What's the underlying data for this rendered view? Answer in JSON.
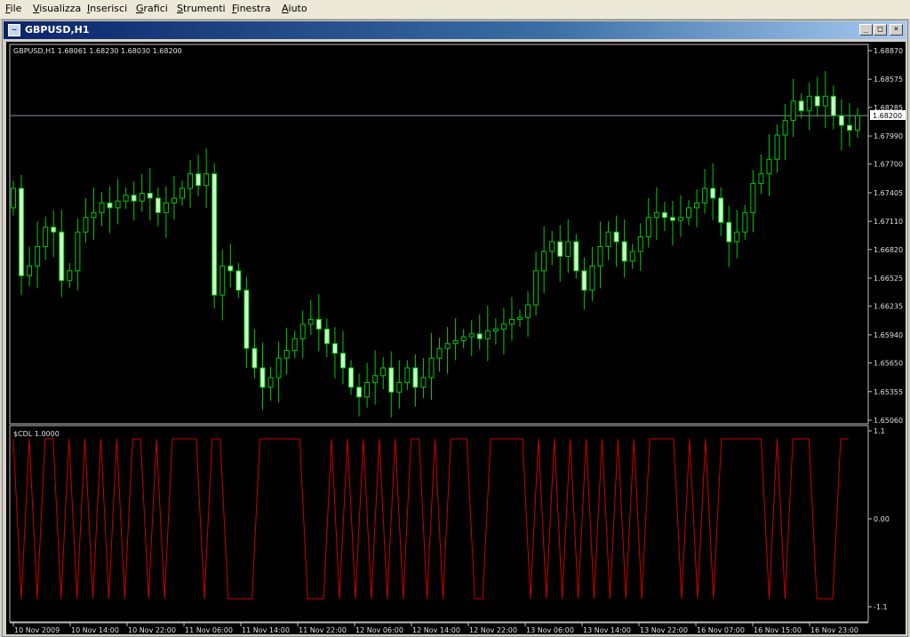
{
  "menu": {
    "items": [
      "File",
      "Visualizza",
      "Inserisci",
      "Grafici",
      "Strumenti",
      "Finestra",
      "Aiuto"
    ]
  },
  "window": {
    "title": "GBPUSD,H1",
    "buttons": {
      "minimize": "_",
      "maximize": "□",
      "close": "×"
    }
  },
  "chart": {
    "header": "GBPUSD,H1  1.68061 1.68230 1.68030 1.68200",
    "indicator_label": "$CDL 1.0000",
    "current_price_label": "1.68200",
    "colors": {
      "background": "#000000",
      "bull_candle": "#ccffcc",
      "wick": "#00cc00",
      "indicator_line": "#cc0000",
      "bid_line": "#7f8fa6"
    }
  },
  "chart_data": [
    {
      "type": "candlestick",
      "title": "GBPUSD,H1",
      "ohlc_last": {
        "open": 1.68061,
        "high": 1.6823,
        "low": 1.6803,
        "close": 1.682
      },
      "y_ticks": [
        "1.68870",
        "1.68575",
        "1.68285",
        "1.67990",
        "1.67700",
        "1.67405",
        "1.67110",
        "1.66820",
        "1.66525",
        "1.66235",
        "1.65940",
        "1.65650",
        "1.65355",
        "1.65060"
      ],
      "ylim": [
        1.6506,
        1.6887
      ],
      "current_price": 1.682,
      "x_ticks": [
        "10 Nov 2009",
        "10 Nov 14:00",
        "10 Nov 22:00",
        "11 Nov 06:00",
        "11 Nov 14:00",
        "11 Nov 22:00",
        "12 Nov 06:00",
        "12 Nov 14:00",
        "12 Nov 22:00",
        "13 Nov 06:00",
        "13 Nov 14:00",
        "13 Nov 22:00",
        "16 Nov 07:00",
        "16 Nov 15:00",
        "16 Nov 23:00"
      ],
      "closes": [
        1.6745,
        1.6655,
        1.6665,
        1.6685,
        1.6705,
        1.67,
        1.665,
        1.666,
        1.67,
        1.6715,
        1.672,
        1.673,
        1.6725,
        1.6732,
        1.6738,
        1.6732,
        1.674,
        1.6735,
        1.672,
        1.673,
        1.6735,
        1.6745,
        1.676,
        1.6748,
        1.676,
        1.6635,
        1.6665,
        1.666,
        1.664,
        1.658,
        1.656,
        1.654,
        1.655,
        1.657,
        1.6578,
        1.659,
        1.6605,
        1.661,
        1.66,
        1.6585,
        1.6575,
        1.656,
        1.654,
        1.653,
        1.6545,
        1.6552,
        1.656,
        1.6535,
        1.6545,
        1.656,
        1.654,
        1.655,
        1.657,
        1.658,
        1.6585,
        1.6588,
        1.6592,
        1.6595,
        1.659,
        1.6598,
        1.66,
        1.6605,
        1.661,
        1.6612,
        1.6625,
        1.666,
        1.668,
        1.669,
        1.6675,
        1.669,
        1.666,
        1.664,
        1.6665,
        1.6685,
        1.67,
        1.669,
        1.667,
        1.668,
        1.6695,
        1.6715,
        1.672,
        1.6715,
        1.6712,
        1.6715,
        1.6725,
        1.673,
        1.6745,
        1.6735,
        1.671,
        1.669,
        1.67,
        1.672,
        1.675,
        1.676,
        1.6775,
        1.68,
        1.6815,
        1.6835,
        1.6825,
        1.684,
        1.683,
        1.684,
        1.682,
        1.681,
        1.6805,
        1.682
      ]
    },
    {
      "type": "line",
      "title": "$CDL 1.0000",
      "ylim": [
        -1.1,
        1.1
      ],
      "y_ticks": [
        "1.1",
        "0.00",
        "-1.1"
      ],
      "series": [
        {
          "values": [
            1,
            -1,
            1,
            -1,
            1,
            1,
            -1,
            1,
            -1,
            1,
            -1,
            1,
            -1,
            1,
            -1,
            1,
            1,
            -1,
            1,
            -1,
            1,
            1,
            1,
            1,
            -1,
            1,
            1,
            -1,
            -1,
            -1,
            -1,
            1,
            1,
            1,
            1,
            1,
            1,
            -1,
            -1,
            -1,
            1,
            -1,
            1,
            -1,
            1,
            -1,
            1,
            -1,
            1,
            -1,
            1,
            1,
            -1,
            1,
            -1,
            1,
            1,
            1,
            -1,
            -1,
            1,
            1,
            1,
            1,
            1,
            -1,
            1,
            -1,
            1,
            -1,
            1,
            -1,
            1,
            -1,
            1,
            -1,
            1,
            -1,
            1,
            -1,
            1,
            1,
            1,
            1,
            -1,
            1,
            -1,
            1,
            -1,
            1,
            1,
            1,
            1,
            1,
            1,
            -1,
            1,
            -1,
            1,
            1,
            1,
            -1,
            -1,
            -1,
            1,
            1
          ]
        }
      ]
    }
  ]
}
